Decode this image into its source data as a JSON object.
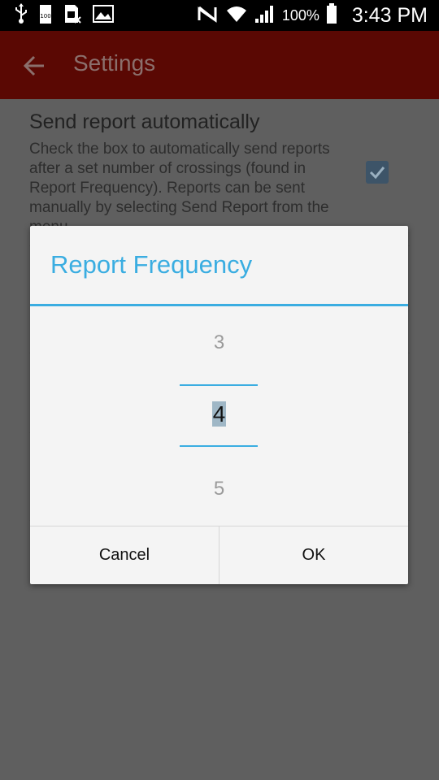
{
  "status_bar": {
    "battery_percent": "100%",
    "time": "3:43 PM",
    "icons": [
      "usb-icon",
      "battery-100-icon",
      "sim-icon",
      "image-icon",
      "no-signal-icon",
      "wifi-icon",
      "signal-bars-icon",
      "battery-icon"
    ]
  },
  "app_bar": {
    "title": "Settings",
    "back_icon": "arrow-back-icon"
  },
  "settings": {
    "send_report": {
      "title": "Send report automatically",
      "summary": "Check the box to automatically send reports after a set number of crossings (found in Report Frequency). Reports can be sent manually by selecting Send Report from the menu.",
      "checked": true
    }
  },
  "dialog": {
    "title": "Report Frequency",
    "picker": {
      "previous": "3",
      "current": "4",
      "next": "5"
    },
    "buttons": {
      "cancel": "Cancel",
      "ok": "OK"
    }
  },
  "colors": {
    "accent": "#3aade1",
    "app_bar": "#5a0803",
    "scrim": "#5f5f5f"
  }
}
